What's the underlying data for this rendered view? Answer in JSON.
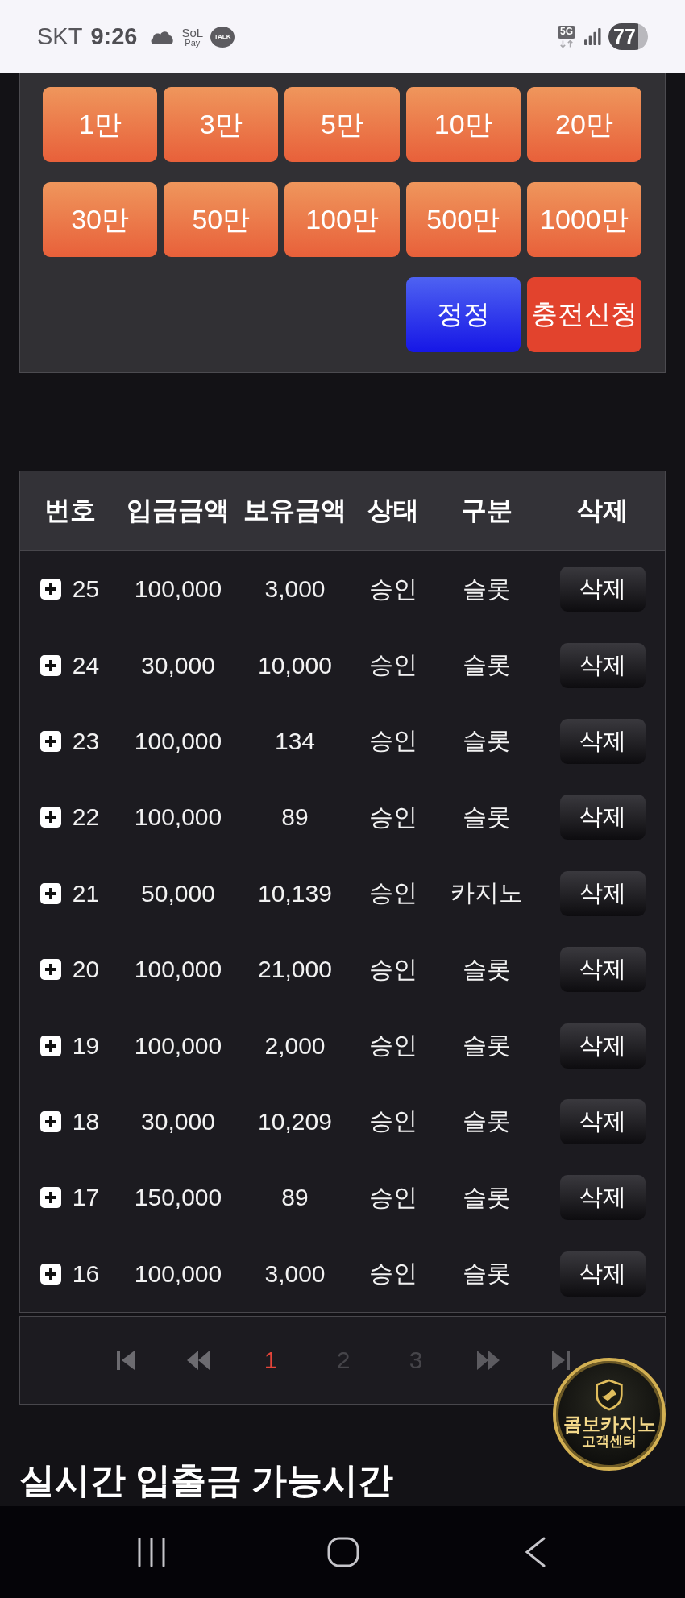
{
  "status_bar": {
    "carrier": "SKT",
    "time": "9:26",
    "pay_app": {
      "top": "SoL",
      "bottom": "Pay"
    },
    "chat_app": "TALK",
    "network": "5G",
    "battery": "77"
  },
  "amount_buttons": [
    "1만",
    "3만",
    "5만",
    "10만",
    "20만",
    "30만",
    "50만",
    "100만",
    "500만",
    "1000만"
  ],
  "action_buttons": [
    {
      "label": "정정",
      "kind": "correct"
    },
    {
      "label": "충전신청",
      "kind": "request"
    }
  ],
  "table": {
    "columns": [
      "번호",
      "입금금액",
      "보유금액",
      "상태",
      "구분",
      "삭제"
    ],
    "rows": [
      {
        "number": "25",
        "deposit": "100,000",
        "balance": "3,000",
        "status": "승인",
        "category": "슬롯",
        "action": "삭제",
        "expanded": false
      },
      {
        "number": "24",
        "deposit": "30,000",
        "balance": "10,000",
        "status": "승인",
        "category": "슬롯",
        "action": "삭제",
        "expanded": false
      },
      {
        "number": "23",
        "deposit": "100,000",
        "balance": "134",
        "status": "승인",
        "category": "슬롯",
        "action": "삭제",
        "expanded": false
      },
      {
        "number": "22",
        "deposit": "100,000",
        "balance": "89",
        "status": "승인",
        "category": "슬롯",
        "action": "삭제",
        "expanded": false
      },
      {
        "number": "21",
        "deposit": "50,000",
        "balance": "10,139",
        "status": "승인",
        "category": "카지노",
        "action": "삭제",
        "expanded": false
      },
      {
        "number": "20",
        "deposit": "100,000",
        "balance": "21,000",
        "status": "승인",
        "category": "슬롯",
        "action": "삭제",
        "expanded": false
      },
      {
        "number": "19",
        "deposit": "100,000",
        "balance": "2,000",
        "status": "승인",
        "category": "슬롯",
        "action": "삭제",
        "expanded": false
      },
      {
        "number": "18",
        "deposit": "30,000",
        "balance": "10,209",
        "status": "승인",
        "category": "슬롯",
        "action": "삭제",
        "expanded": false
      },
      {
        "number": "17",
        "deposit": "150,000",
        "balance": "89",
        "status": "승인",
        "category": "슬롯",
        "action": "삭제",
        "expanded": false
      },
      {
        "number": "16",
        "deposit": "100,000",
        "balance": "3,000",
        "status": "승인",
        "category": "슬롯",
        "action": "삭제",
        "expanded": false
      }
    ]
  },
  "pagination": {
    "pages": [
      {
        "label": "1",
        "selected": true
      },
      {
        "label": "2",
        "selected": false
      },
      {
        "label": "3",
        "selected": false
      }
    ]
  },
  "section_heading": "실시간 입출금 가능시간",
  "support_badge": {
    "title": "콤보카지노",
    "subtitle": "고객센터"
  }
}
